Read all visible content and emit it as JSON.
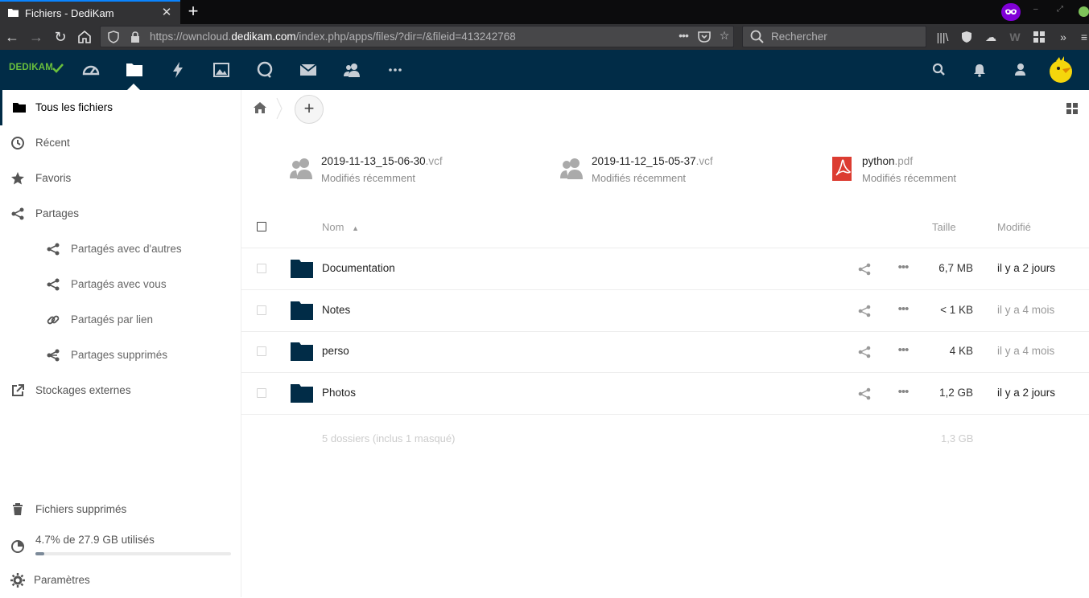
{
  "browser": {
    "tab_title": "Fichiers - DediKam",
    "url_prefix": "https://owncloud.",
    "url_domain": "dedikam.com",
    "url_path": "/index.php/apps/files/?dir=/&fileid=413242768",
    "search_placeholder": "Rechercher"
  },
  "app": {
    "logo_text": "DEDIKAM",
    "brand_color": "#012c47",
    "accent_green": "#6abf3c"
  },
  "header_icons": [
    "dashboard-icon",
    "files-icon",
    "activity-icon",
    "gallery-icon",
    "talk-icon",
    "mail-icon",
    "contacts-icon",
    "more-apps-icon"
  ],
  "header_right_icons": [
    "search-icon",
    "notifications-icon",
    "contacts-menu-icon",
    "avatar"
  ],
  "sidebar": {
    "items": [
      {
        "label": "Tous les fichiers",
        "icon": "folder-icon"
      },
      {
        "label": "Récent",
        "icon": "clock-icon"
      },
      {
        "label": "Favoris",
        "icon": "star-icon"
      },
      {
        "label": "Partages",
        "icon": "share-icon"
      },
      {
        "label": "Partagés avec d'autres",
        "icon": "share-icon"
      },
      {
        "label": "Partagés avec vous",
        "icon": "share-icon"
      },
      {
        "label": "Partagés par lien",
        "icon": "link-icon"
      },
      {
        "label": "Partages supprimés",
        "icon": "share-deleted-icon"
      },
      {
        "label": "Stockages externes",
        "icon": "external-icon"
      }
    ],
    "trash_label": "Fichiers supprimés",
    "quota_label": "4.7% de 27.9 GB utilisés",
    "quota_fraction": 0.047,
    "settings_label": "Paramètres"
  },
  "recent_files": [
    {
      "name": "2019-11-13_15-06-30",
      "ext": ".vcf",
      "status": "Modifiés récemment",
      "icon": "contact-icon"
    },
    {
      "name": "2019-11-12_15-05-37",
      "ext": ".vcf",
      "status": "Modifiés récemment",
      "icon": "contact-icon"
    },
    {
      "name": "python",
      "ext": ".pdf",
      "status": "Modifiés récemment",
      "icon": "pdf-icon"
    }
  ],
  "table": {
    "col_name": "Nom",
    "col_size": "Taille",
    "col_modified": "Modifié",
    "rows": [
      {
        "name": "Documentation",
        "size": "6,7 MB",
        "modified": "il y a 2 jours"
      },
      {
        "name": "Notes",
        "size": "< 1 KB",
        "modified": "il y a 4 mois"
      },
      {
        "name": "perso",
        "size": "4 KB",
        "modified": "il y a 4 mois"
      },
      {
        "name": "Photos",
        "size": "1,2 GB",
        "modified": "il y a 2 jours"
      }
    ],
    "summary_label": "5 dossiers (inclus 1 masqué)",
    "summary_size": "1,3 GB"
  }
}
